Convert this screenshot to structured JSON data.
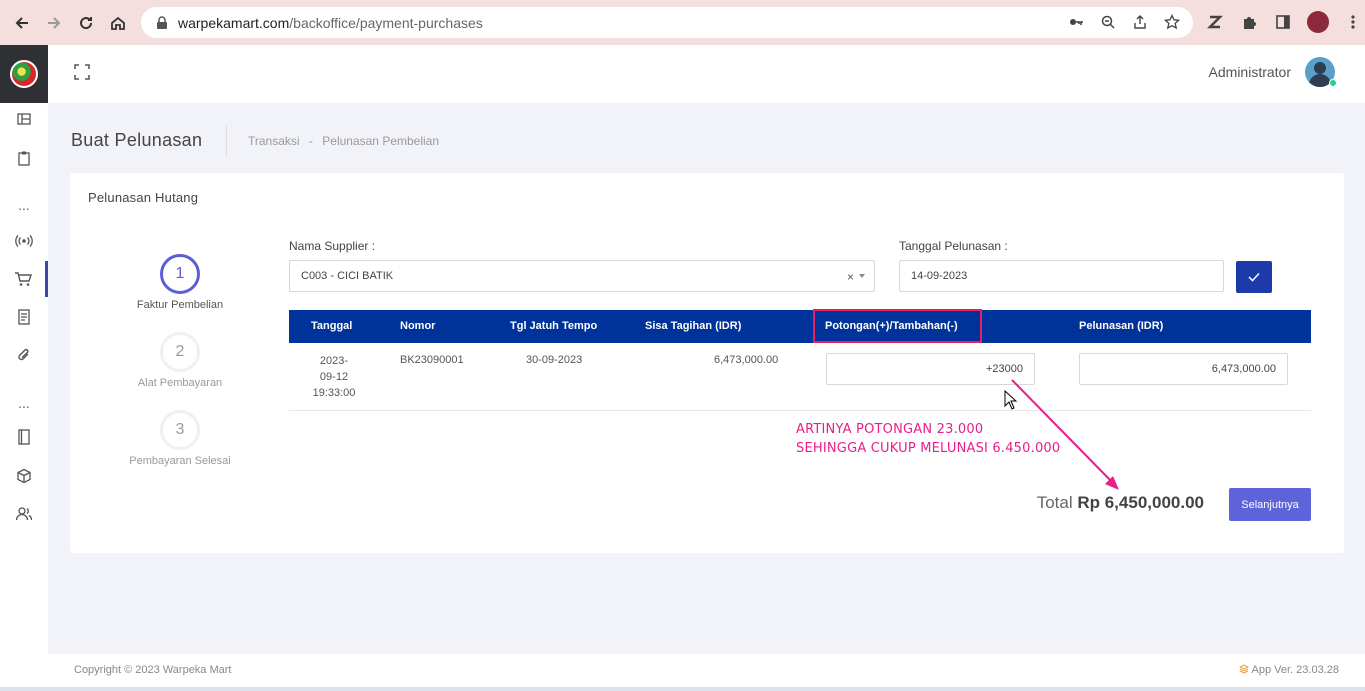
{
  "browser": {
    "url_host": "warpekamart.com",
    "url_path": "/backoffice/payment-purchases"
  },
  "header": {
    "admin_name": "Administrator"
  },
  "page": {
    "title": "Buat Pelunasan",
    "breadcrumb": [
      "Transaksi",
      "-",
      "Pelunasan Pembelian"
    ]
  },
  "card": {
    "title": "Pelunasan Hutang"
  },
  "steps": [
    {
      "number": "1",
      "label": "Faktur Pembelian"
    },
    {
      "number": "2",
      "label": "Alat Pembayaran"
    },
    {
      "number": "3",
      "label": "Pembayaran Selesai"
    }
  ],
  "form": {
    "supplier_label": "Nama Supplier :",
    "supplier_value": "C003 - CICI BATIK",
    "date_label": "Tanggal Pelunasan :",
    "date_value": "14-09-2023"
  },
  "table": {
    "headers": [
      "Tanggal",
      "Nomor",
      "Tgl Jatuh Tempo",
      "Sisa Tagihan (IDR)",
      "Potongan(+)/Tambahan(-)",
      "Pelunasan (IDR)"
    ],
    "rows": [
      {
        "tanggal_lines": [
          "2023-",
          "09-12",
          "19:33:00"
        ],
        "nomor": "BK23090001",
        "jatuh_tempo": "30-09-2023",
        "sisa_tagihan": "6,473,000.00",
        "potongan": "+23000",
        "pelunasan": "6,473,000.00"
      }
    ]
  },
  "annotation": {
    "line1": "ARTINYA POTONGAN 23.000",
    "line2": "SEHINGGA CUKUP MELUNASI 6.450.000",
    "color": "#e91e8a"
  },
  "total": {
    "label": "Total",
    "amount": "Rp 6,450,000.00"
  },
  "next_button": "Selanjutnya",
  "footer": {
    "copyright": "Copyright © 2023 Warpeka Mart",
    "version": "App Ver. 23.03.28"
  },
  "colors": {
    "primary": "#003399",
    "accent": "#5d63d8",
    "highlight": "#e91e63"
  }
}
